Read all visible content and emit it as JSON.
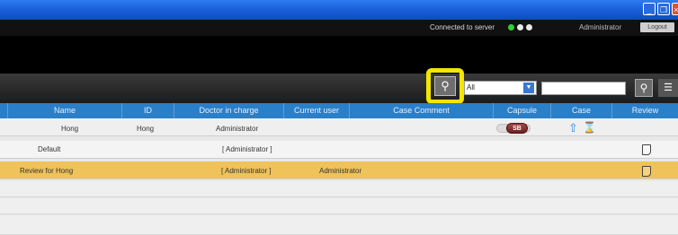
{
  "window": {
    "min": "_",
    "max": "❐",
    "close": "×"
  },
  "status": {
    "connection_text": "Connected to server",
    "user": "Administrator",
    "logout_label": "Logout",
    "colors": {
      "dot_active": "#34d03a",
      "dot_idle": "#e8e8e8"
    }
  },
  "toolbar": {
    "filter_value": "All",
    "search_value": "",
    "icons": {
      "finder": "search-icon",
      "search": "search-icon",
      "list": "list-icon"
    },
    "highlight_color": "#f3e600"
  },
  "table": {
    "columns": [
      "Name",
      "ID",
      "Doctor in charge",
      "Current user",
      "Case Comment",
      "Capsule",
      "Case",
      "Review"
    ],
    "rows": [
      {
        "name": "Hong",
        "id": "Hong",
        "doctor": "Administrator",
        "current_user": "",
        "capsule": "SB",
        "case_icons": [
          "upload-icon",
          "hourglass-icon"
        ],
        "review_icon": ""
      },
      {
        "name": "Default",
        "id": "",
        "doctor": "[ Administrator ]",
        "current_user": "",
        "capsule": "",
        "review_icon": "document-icon"
      },
      {
        "name": "Review for Hong",
        "id": "",
        "doctor": "[ Administrator ]",
        "current_user": "Administrator",
        "capsule": "",
        "review_icon": "document-icon",
        "selected": true
      }
    ],
    "colors": {
      "header": "#2a7fc9",
      "selected_row": "#efc25a"
    }
  }
}
